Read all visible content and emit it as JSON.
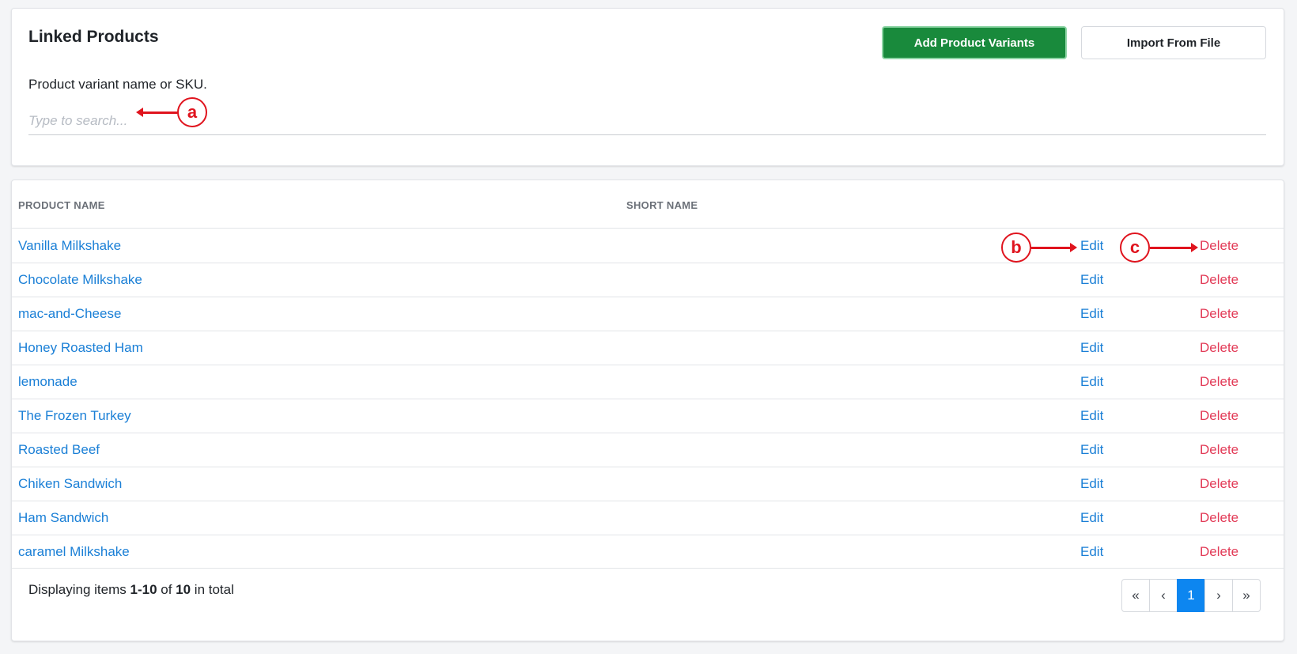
{
  "header": {
    "title": "Linked Products",
    "add_button": "Add Product Variants",
    "import_button": "Import From File"
  },
  "search": {
    "label": "Product variant name or SKU.",
    "placeholder": "Type to search..."
  },
  "annotations": {
    "a": "a",
    "b": "b",
    "c": "c"
  },
  "table": {
    "columns": [
      "PRODUCT NAME",
      "SHORT NAME"
    ],
    "edit_label": "Edit",
    "delete_label": "Delete",
    "rows": [
      {
        "name": "Vanilla Milkshake",
        "short_name": ""
      },
      {
        "name": "Chocolate Milkshake",
        "short_name": ""
      },
      {
        "name": "mac-and-Cheese",
        "short_name": ""
      },
      {
        "name": "Honey Roasted Ham",
        "short_name": ""
      },
      {
        "name": "lemonade",
        "short_name": ""
      },
      {
        "name": "The Frozen Turkey",
        "short_name": ""
      },
      {
        "name": "Roasted Beef",
        "short_name": ""
      },
      {
        "name": "Chiken Sandwich",
        "short_name": ""
      },
      {
        "name": "Ham Sandwich",
        "short_name": ""
      },
      {
        "name": "caramel Milkshake",
        "short_name": ""
      }
    ]
  },
  "footer": {
    "prefix": "Displaying items ",
    "range": "1-10",
    "of": " of ",
    "total": "10",
    "suffix": " in total"
  },
  "pagination": {
    "first": "«",
    "prev": "‹",
    "current": "1",
    "next": "›",
    "last": "»"
  },
  "colors": {
    "primary_button": "#198a3c",
    "link": "#1a7fd6",
    "delete": "#e23a56",
    "annotation": "#e0141e",
    "active_page": "#0d86f0"
  }
}
